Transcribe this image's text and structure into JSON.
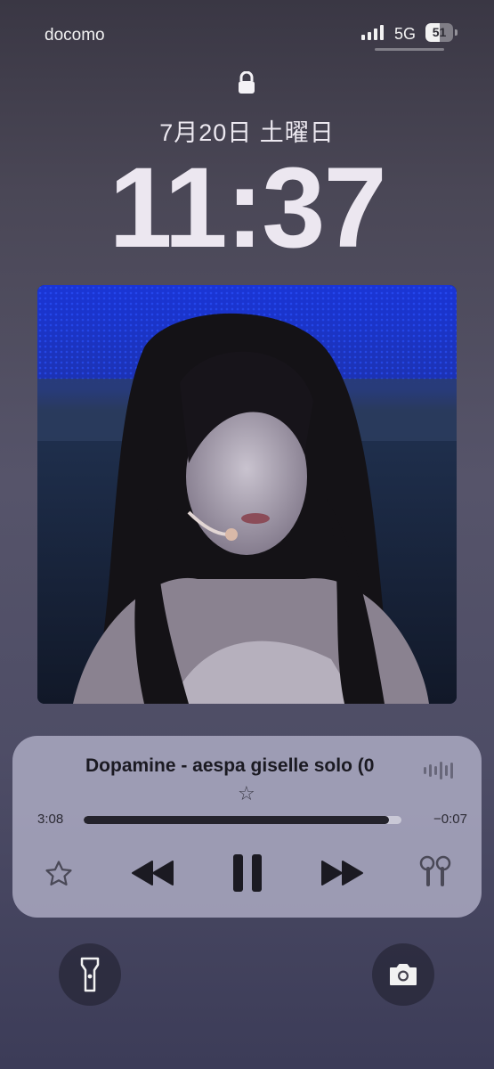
{
  "status_bar": {
    "carrier": "docomo",
    "network": "5G",
    "battery_percent": "51",
    "battery_level": 0.51,
    "signal_bars": 4
  },
  "lock_screen": {
    "lock_icon": "lock-icon",
    "date": "7月20日 土曜日",
    "time": "11:37"
  },
  "now_playing": {
    "artwork_icon": "album-artwork",
    "title": "Dopamine - aespa giselle solo (0",
    "title_star": "☆",
    "elapsed": "3:08",
    "remaining": "−0:07",
    "progress": 0.96,
    "controls": {
      "favorite": "star-icon",
      "previous": "rewind-icon",
      "play_pause": "pause-icon",
      "next": "fast-forward-icon",
      "output": "airpods-icon"
    }
  },
  "quick_actions": {
    "left": "flashlight-icon",
    "right": "camera-icon"
  }
}
